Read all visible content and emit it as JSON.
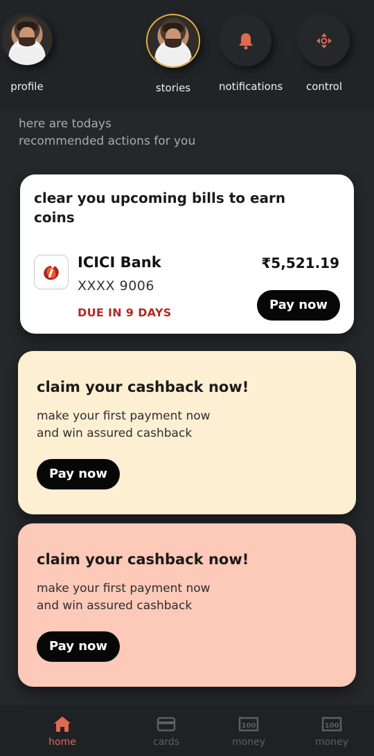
{
  "header": {
    "items": [
      {
        "label": "profile",
        "icon": "avatar"
      },
      {
        "label": "stories",
        "icon": "avatar"
      },
      {
        "label": "notifications",
        "icon": "bell-icon"
      },
      {
        "label": "control",
        "icon": "move-icon"
      }
    ]
  },
  "intro": {
    "line1": "here are todays",
    "line2": "recommended actions for you"
  },
  "bill_card": {
    "title": "clear you upcoming bills to earn coins",
    "bank": "ICICI Bank",
    "account": "XXXX 9006",
    "due": "DUE IN 9 DAYS",
    "amount": "₹5,521.19",
    "button": "Pay now"
  },
  "promos": [
    {
      "title": "claim your cashback now!",
      "line1": "make your first payment now",
      "line2": "and win assured cashback",
      "button": "Pay now",
      "color": "#fdefd2"
    },
    {
      "title": "claim your cashback now!",
      "line1": "make your first payment now",
      "line2": "and win assured cashback",
      "button": "Pay now",
      "color": "#fdc9b8"
    }
  ],
  "bottom_nav": [
    {
      "label": "home",
      "icon": "home-icon",
      "active": true
    },
    {
      "label": "cards",
      "icon": "card-icon",
      "active": false
    },
    {
      "label": "money",
      "icon": "money-icon",
      "active": false
    },
    {
      "label": "money",
      "icon": "money-icon",
      "active": false
    }
  ],
  "colors": {
    "accent": "#e0694f",
    "ring": "#e8b23a",
    "due": "#b02a24",
    "background": "#25282b"
  }
}
